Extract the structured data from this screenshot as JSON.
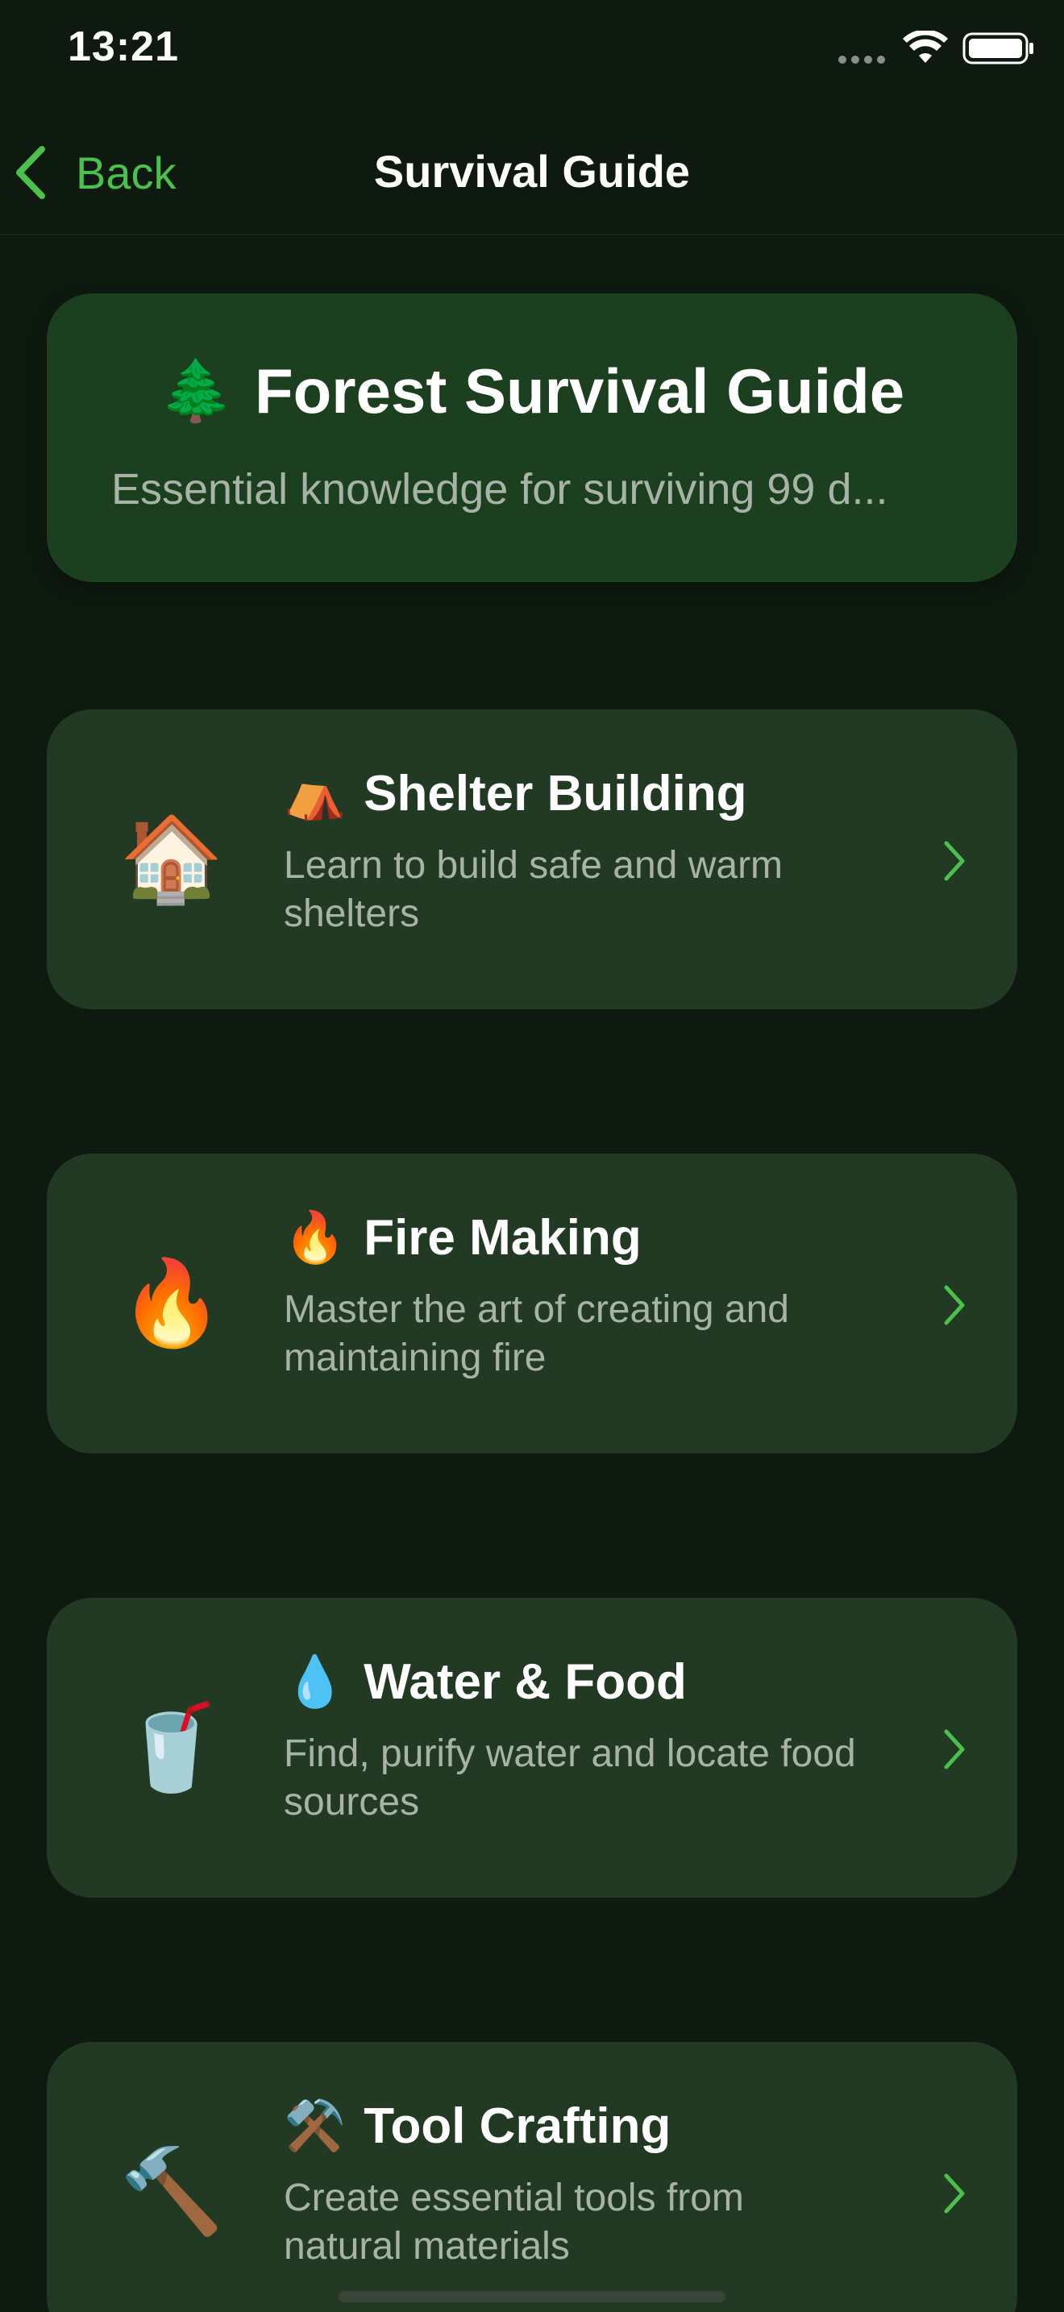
{
  "status_bar": {
    "time": "13:21"
  },
  "nav": {
    "back_label": "Back",
    "title": "Survival Guide"
  },
  "header": {
    "emoji": "🌲",
    "title": "Forest Survival Guide",
    "subtitle": "Essential knowledge for surviving 99 d..."
  },
  "sections": [
    {
      "icon": "🏠",
      "title_emoji": "⛺",
      "title": "Shelter Building",
      "description": "Learn to build safe and warm shelters"
    },
    {
      "icon": "🔥",
      "title_emoji": "🔥",
      "title": "Fire Making",
      "description": "Master the art of creating and maintaining fire"
    },
    {
      "icon": "🥤",
      "title_emoji": "💧",
      "title": "Water & Food",
      "description": "Find, purify water and locate food sources"
    },
    {
      "icon": "🔨",
      "title_emoji": "⚒️",
      "title": "Tool Crafting",
      "description": "Create essential tools from natural materials"
    }
  ],
  "colors": {
    "background": "#0e1a10",
    "header_card": "#1c3f1f",
    "section_card": "#223a24",
    "accent_green": "#4cc04c",
    "secondary_text": "#a8b3a8"
  }
}
